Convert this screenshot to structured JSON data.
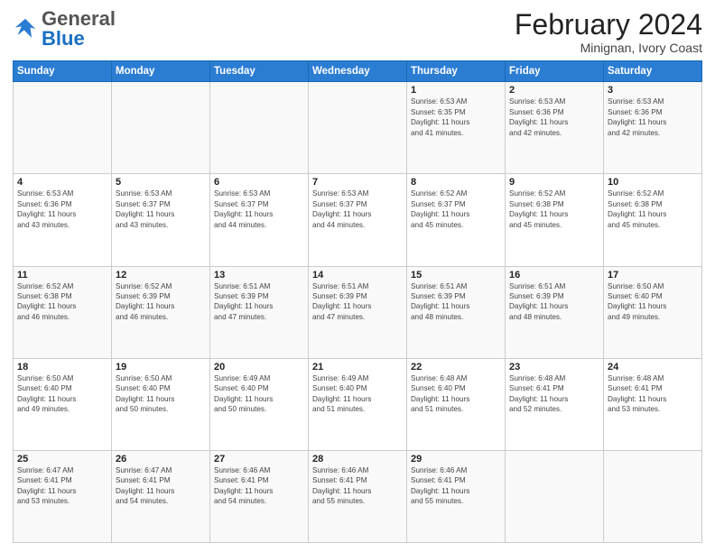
{
  "header": {
    "logo_general": "General",
    "logo_blue": "Blue",
    "month_year": "February 2024",
    "location": "Minignan, Ivory Coast"
  },
  "weekdays": [
    "Sunday",
    "Monday",
    "Tuesday",
    "Wednesday",
    "Thursday",
    "Friday",
    "Saturday"
  ],
  "weeks": [
    [
      {
        "day": "",
        "info": ""
      },
      {
        "day": "",
        "info": ""
      },
      {
        "day": "",
        "info": ""
      },
      {
        "day": "",
        "info": ""
      },
      {
        "day": "1",
        "info": "Sunrise: 6:53 AM\nSunset: 6:35 PM\nDaylight: 11 hours\nand 41 minutes."
      },
      {
        "day": "2",
        "info": "Sunrise: 6:53 AM\nSunset: 6:36 PM\nDaylight: 11 hours\nand 42 minutes."
      },
      {
        "day": "3",
        "info": "Sunrise: 6:53 AM\nSunset: 6:36 PM\nDaylight: 11 hours\nand 42 minutes."
      }
    ],
    [
      {
        "day": "4",
        "info": "Sunrise: 6:53 AM\nSunset: 6:36 PM\nDaylight: 11 hours\nand 43 minutes."
      },
      {
        "day": "5",
        "info": "Sunrise: 6:53 AM\nSunset: 6:37 PM\nDaylight: 11 hours\nand 43 minutes."
      },
      {
        "day": "6",
        "info": "Sunrise: 6:53 AM\nSunset: 6:37 PM\nDaylight: 11 hours\nand 44 minutes."
      },
      {
        "day": "7",
        "info": "Sunrise: 6:53 AM\nSunset: 6:37 PM\nDaylight: 11 hours\nand 44 minutes."
      },
      {
        "day": "8",
        "info": "Sunrise: 6:52 AM\nSunset: 6:37 PM\nDaylight: 11 hours\nand 45 minutes."
      },
      {
        "day": "9",
        "info": "Sunrise: 6:52 AM\nSunset: 6:38 PM\nDaylight: 11 hours\nand 45 minutes."
      },
      {
        "day": "10",
        "info": "Sunrise: 6:52 AM\nSunset: 6:38 PM\nDaylight: 11 hours\nand 45 minutes."
      }
    ],
    [
      {
        "day": "11",
        "info": "Sunrise: 6:52 AM\nSunset: 6:38 PM\nDaylight: 11 hours\nand 46 minutes."
      },
      {
        "day": "12",
        "info": "Sunrise: 6:52 AM\nSunset: 6:39 PM\nDaylight: 11 hours\nand 46 minutes."
      },
      {
        "day": "13",
        "info": "Sunrise: 6:51 AM\nSunset: 6:39 PM\nDaylight: 11 hours\nand 47 minutes."
      },
      {
        "day": "14",
        "info": "Sunrise: 6:51 AM\nSunset: 6:39 PM\nDaylight: 11 hours\nand 47 minutes."
      },
      {
        "day": "15",
        "info": "Sunrise: 6:51 AM\nSunset: 6:39 PM\nDaylight: 11 hours\nand 48 minutes."
      },
      {
        "day": "16",
        "info": "Sunrise: 6:51 AM\nSunset: 6:39 PM\nDaylight: 11 hours\nand 48 minutes."
      },
      {
        "day": "17",
        "info": "Sunrise: 6:50 AM\nSunset: 6:40 PM\nDaylight: 11 hours\nand 49 minutes."
      }
    ],
    [
      {
        "day": "18",
        "info": "Sunrise: 6:50 AM\nSunset: 6:40 PM\nDaylight: 11 hours\nand 49 minutes."
      },
      {
        "day": "19",
        "info": "Sunrise: 6:50 AM\nSunset: 6:40 PM\nDaylight: 11 hours\nand 50 minutes."
      },
      {
        "day": "20",
        "info": "Sunrise: 6:49 AM\nSunset: 6:40 PM\nDaylight: 11 hours\nand 50 minutes."
      },
      {
        "day": "21",
        "info": "Sunrise: 6:49 AM\nSunset: 6:40 PM\nDaylight: 11 hours\nand 51 minutes."
      },
      {
        "day": "22",
        "info": "Sunrise: 6:48 AM\nSunset: 6:40 PM\nDaylight: 11 hours\nand 51 minutes."
      },
      {
        "day": "23",
        "info": "Sunrise: 6:48 AM\nSunset: 6:41 PM\nDaylight: 11 hours\nand 52 minutes."
      },
      {
        "day": "24",
        "info": "Sunrise: 6:48 AM\nSunset: 6:41 PM\nDaylight: 11 hours\nand 53 minutes."
      }
    ],
    [
      {
        "day": "25",
        "info": "Sunrise: 6:47 AM\nSunset: 6:41 PM\nDaylight: 11 hours\nand 53 minutes."
      },
      {
        "day": "26",
        "info": "Sunrise: 6:47 AM\nSunset: 6:41 PM\nDaylight: 11 hours\nand 54 minutes."
      },
      {
        "day": "27",
        "info": "Sunrise: 6:46 AM\nSunset: 6:41 PM\nDaylight: 11 hours\nand 54 minutes."
      },
      {
        "day": "28",
        "info": "Sunrise: 6:46 AM\nSunset: 6:41 PM\nDaylight: 11 hours\nand 55 minutes."
      },
      {
        "day": "29",
        "info": "Sunrise: 6:46 AM\nSunset: 6:41 PM\nDaylight: 11 hours\nand 55 minutes."
      },
      {
        "day": "",
        "info": ""
      },
      {
        "day": "",
        "info": ""
      }
    ]
  ]
}
